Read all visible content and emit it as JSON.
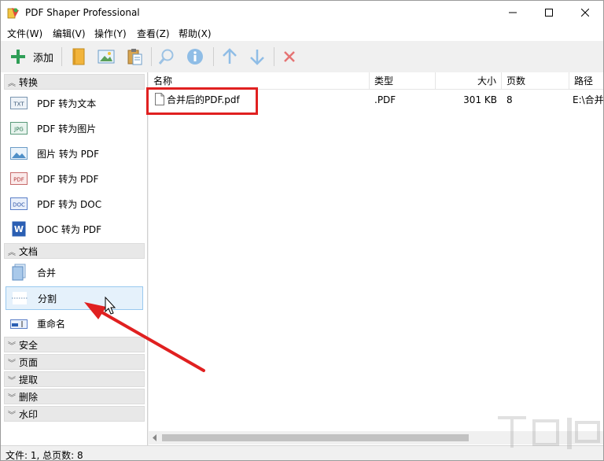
{
  "window": {
    "title": "PDF Shaper Professional"
  },
  "menu": [
    "文件(W)",
    "编辑(V)",
    "操作(Y)",
    "查看(Z)",
    "帮助(X)"
  ],
  "toolbar": {
    "add_label": "添加"
  },
  "sidebar": {
    "categories": {
      "convert": "转换",
      "document": "文档",
      "security": "安全",
      "page": "页面",
      "extract": "提取",
      "delete": "删除",
      "watermark": "水印"
    },
    "convert_items": [
      {
        "label": "PDF 转为文本",
        "icon_text": "TXT"
      },
      {
        "label": "PDF 转为图片",
        "icon_text": "JPG"
      },
      {
        "label": "图片 转为 PDF",
        "icon_text": ""
      },
      {
        "label": "PDF 转为 PDF",
        "icon_text": "PDF"
      },
      {
        "label": "PDF 转为 DOC",
        "icon_text": "DOC"
      },
      {
        "label": "DOC 转为 PDF",
        "icon_text": "W"
      }
    ],
    "document_items": [
      {
        "label": "合并"
      },
      {
        "label": "分割"
      },
      {
        "label": "重命名"
      }
    ]
  },
  "list": {
    "headers": {
      "name": "名称",
      "type": "类型",
      "size": "大小",
      "pages": "页数",
      "path": "路径"
    },
    "rows": [
      {
        "name": "合并后的PDF.pdf",
        "type": ".PDF",
        "size": "301 KB",
        "pages": "8",
        "path": "E:\\合并"
      }
    ]
  },
  "status": {
    "text": "文件: 1, 总页数: 8"
  },
  "colors": {
    "accent": "#3c9ad6",
    "highlight": "#e02020",
    "selected_bg": "#e5f1fb"
  }
}
